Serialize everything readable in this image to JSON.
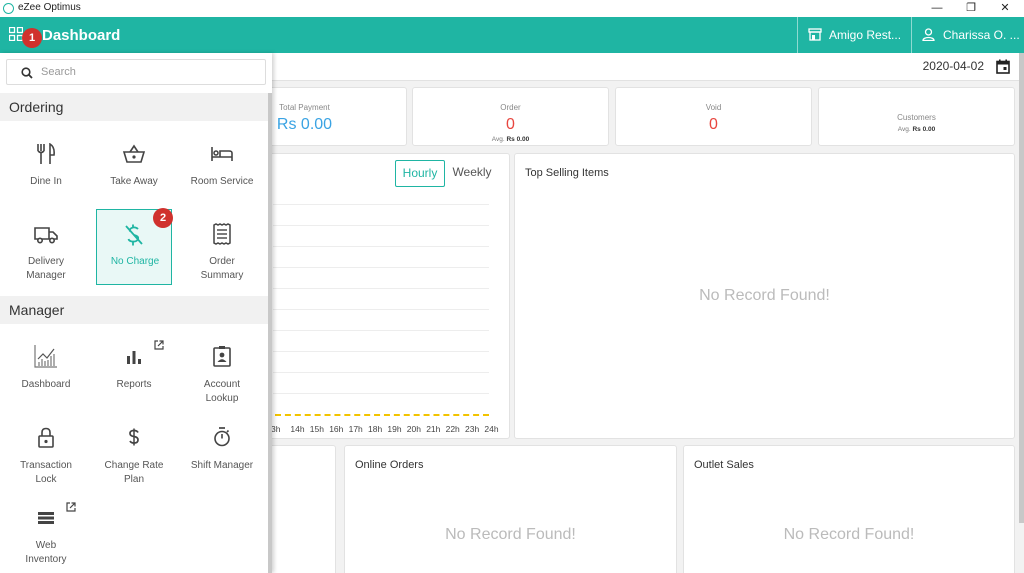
{
  "window": {
    "title": "eZee Optimus",
    "minimize": "—",
    "restore": "❐",
    "close": "✕"
  },
  "header": {
    "title": "Dashboard",
    "outlet": "Amigo Rest...",
    "user": "Charissa O. ..."
  },
  "badges": {
    "first": "1",
    "second": "2"
  },
  "dashboard": {
    "date": "2020-04-02",
    "stats": {
      "total_payment": {
        "label": "Total Payment",
        "value": "Rs 0.00"
      },
      "order": {
        "label": "Order",
        "value": "0",
        "avg_label": "Avg.",
        "avg_value": "Rs 0.00"
      },
      "void": {
        "label": "Void",
        "value": "0"
      },
      "customers": {
        "label": "Customers",
        "avg_label": "Avg.",
        "avg_value": "Rs 0.00"
      }
    },
    "chart": {
      "toggle_hourly": "Hourly",
      "toggle_weekly": "Weekly",
      "hours": [
        "3h",
        "14h",
        "15h",
        "16h",
        "17h",
        "18h",
        "19h",
        "20h",
        "21h",
        "22h",
        "23h",
        "24h"
      ]
    },
    "top_selling": {
      "title": "Top Selling Items",
      "empty": "No Record Found!"
    },
    "online_orders": {
      "title": "Online Orders",
      "empty": "No Record Found!"
    },
    "outlet_sales": {
      "title": "Outlet Sales",
      "empty": "No Record Found!"
    }
  },
  "sidebar": {
    "search_placeholder": "Search",
    "ordering_title": "Ordering",
    "ordering": [
      {
        "label": "Dine In",
        "icon": "dine-in-icon"
      },
      {
        "label": "Take Away",
        "icon": "basket-icon"
      },
      {
        "label": "Room Service",
        "icon": "bed-icon"
      },
      {
        "label": "Delivery Manager",
        "line1": "Delivery",
        "line2": "Manager",
        "icon": "truck-icon"
      },
      {
        "label": "No Charge",
        "icon": "no-charge-icon"
      },
      {
        "label": "Order Summary",
        "line1": "Order",
        "line2": "Summary",
        "icon": "receipt-icon"
      }
    ],
    "manager_title": "Manager",
    "manager": [
      {
        "label": "Dashboard",
        "icon": "chart-line-icon"
      },
      {
        "label": "Reports",
        "icon": "bar-chart-icon"
      },
      {
        "label": "Account Lookup",
        "line1": "Account",
        "line2": "Lookup",
        "icon": "id-card-icon"
      },
      {
        "label": "Transaction Lock",
        "line1": "Transaction",
        "line2": "Lock",
        "icon": "lock-icon"
      },
      {
        "label": "Change Rate Plan",
        "line1": "Change Rate",
        "line2": "Plan",
        "icon": "dollar-icon"
      },
      {
        "label": "Shift Manager",
        "icon": "stopwatch-icon"
      },
      {
        "label": "Web Inventory",
        "line1": "Web",
        "line2": "Inventory",
        "icon": "stack-icon"
      }
    ]
  },
  "colors": {
    "accent": "#1fb5a3",
    "blue_value": "#3aa3e3",
    "red_value": "#e8463f",
    "badge": "#d0312d",
    "chart_baseline": "#f2c300"
  }
}
